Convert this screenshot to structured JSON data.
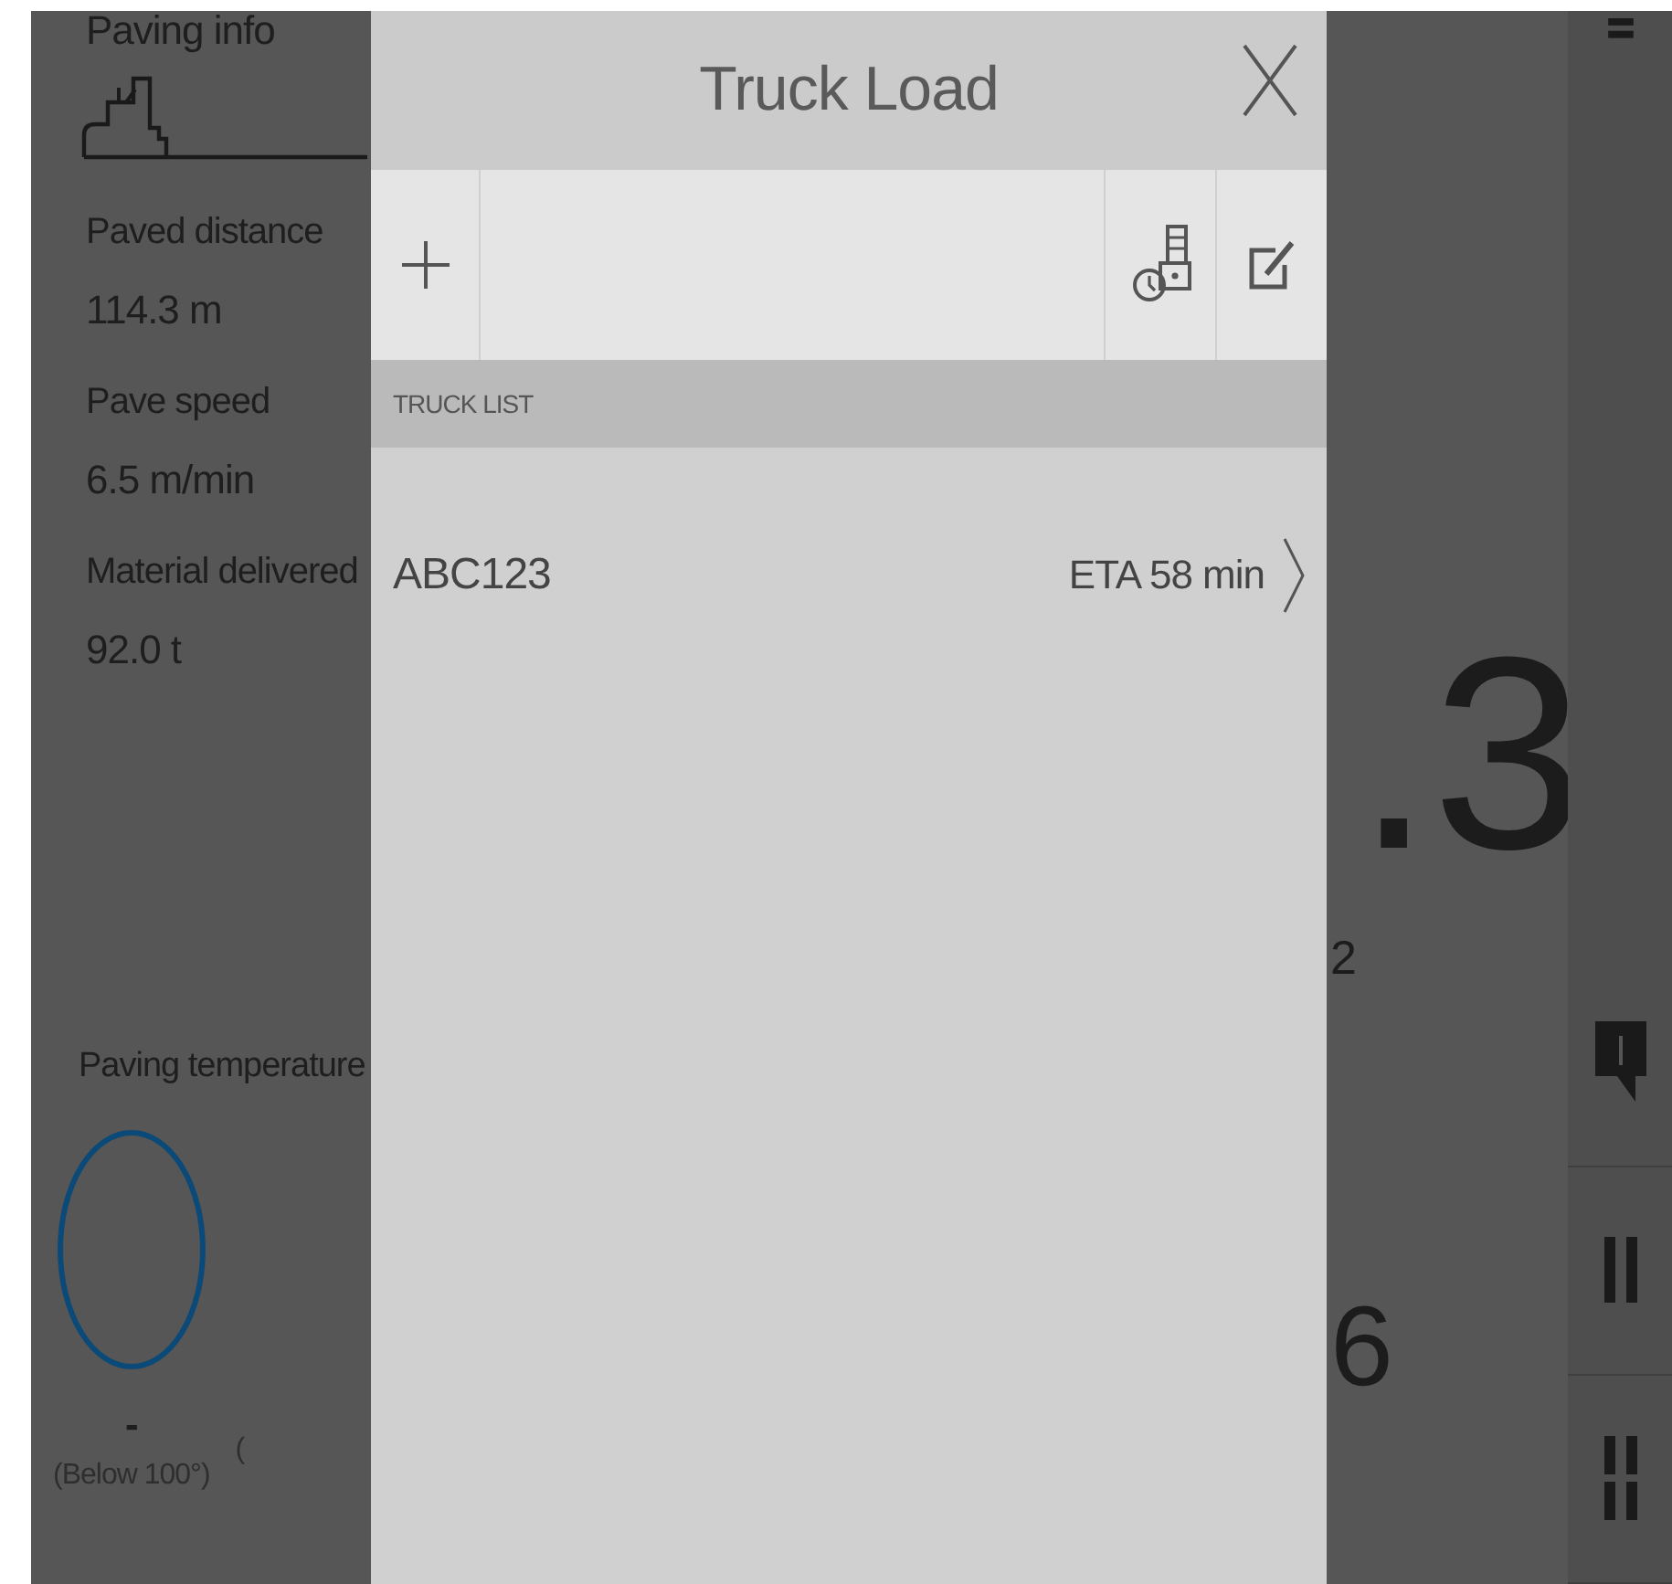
{
  "paving_info": {
    "title": "Paving info",
    "stats": [
      {
        "label": "Paved distance",
        "value": "114.3 m"
      },
      {
        "label": "Pave speed",
        "value": "6.5 m/min"
      },
      {
        "label": "Material delivered",
        "value": "92.0 t"
      }
    ]
  },
  "paving_temperature": {
    "title": "Paving temperature",
    "readings": [
      {
        "value": "-",
        "range": "(Below 100°)",
        "color": "#0b4a78"
      }
    ],
    "next_range": "("
  },
  "main_readings": [
    {
      "kind": "large",
      "value": ".3"
    },
    {
      "kind": "small",
      "value": "2"
    },
    {
      "kind": "medium",
      "value": "6"
    }
  ],
  "dialog": {
    "title": "Truck Load",
    "section": "TRUCK LIST",
    "trucks": [
      {
        "name": "ABC123",
        "eta": "ETA 58 min"
      }
    ]
  }
}
